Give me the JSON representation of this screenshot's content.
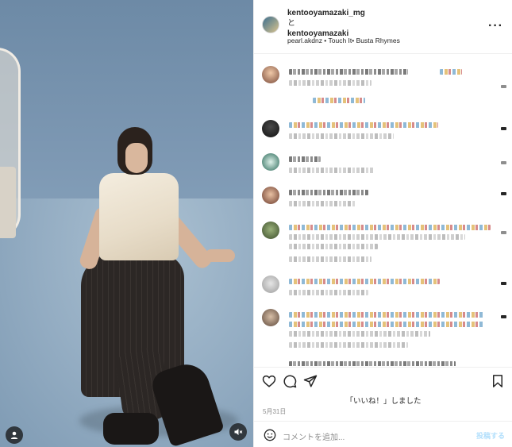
{
  "header": {
    "user1": "kentooyamazaki_mg",
    "conjunction": "と",
    "user2": "kentooyamazaki",
    "audio": "pearl.akdnz • Touch It• Busta Rhymes",
    "more_icon": "more-horizontal-icon"
  },
  "media": {
    "user_tag_icon": "user-tag-icon",
    "mute_icon": "speaker-muted-icon"
  },
  "comments": {
    "note": ""
  },
  "actions": {
    "like_icon": "heart-icon",
    "comment_icon": "comment-icon",
    "share_icon": "send-icon",
    "save_icon": "bookmark-icon"
  },
  "likes_text": "「いいね！」しました",
  "date": "5月31日",
  "composer": {
    "placeholder": "コメントを追加...",
    "post_label": "投稿する",
    "emoji_icon": "emoji-icon"
  },
  "colors": {
    "background": "#ffffff",
    "border": "#efefef",
    "post_button": "#b2dffc",
    "muted_text": "#8e8e8e"
  }
}
